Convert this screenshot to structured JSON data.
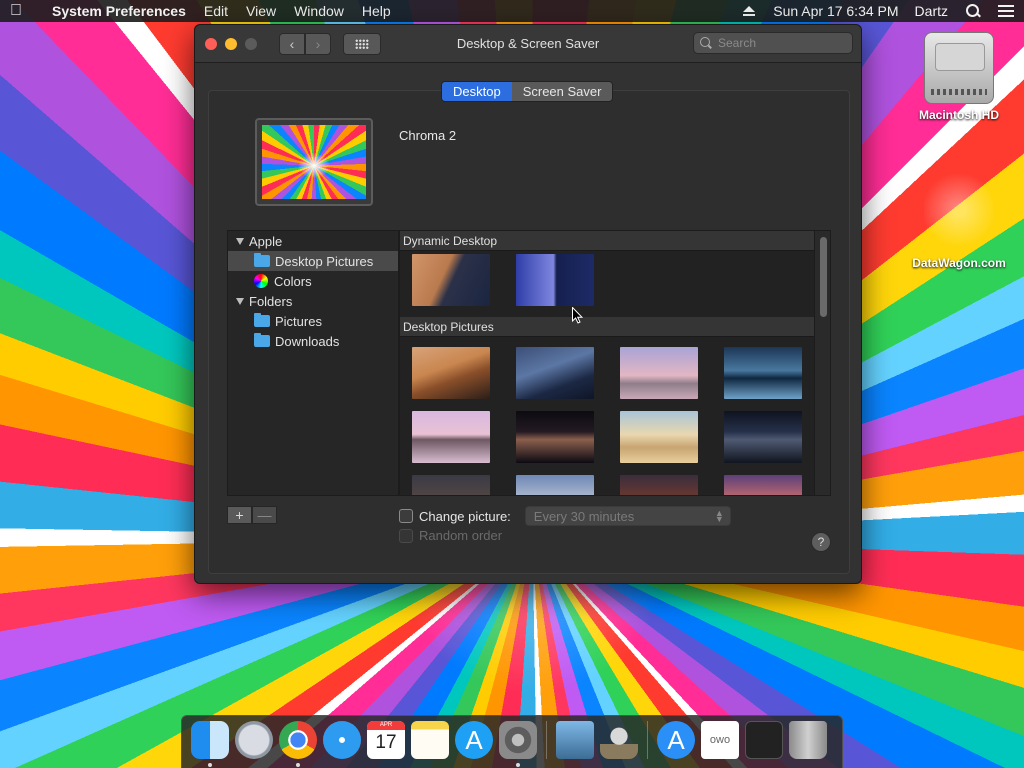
{
  "menubar": {
    "app_name": "System Preferences",
    "menus": [
      "Edit",
      "View",
      "Window",
      "Help"
    ],
    "datetime": "Sun Apr 17  6:34 PM",
    "user": "Dartz"
  },
  "desktop_icons": {
    "hd_label": "Macintosh HD",
    "dw_label": "DataWagon.com"
  },
  "window": {
    "title": "Desktop & Screen Saver",
    "search_placeholder": "Search",
    "tabs": [
      {
        "label": "Desktop",
        "active": true
      },
      {
        "label": "Screen Saver",
        "active": false
      }
    ],
    "current_picture_name": "Chroma 2",
    "sources": [
      {
        "label": "Apple",
        "type": "group"
      },
      {
        "label": "Desktop Pictures",
        "type": "child",
        "selected": true,
        "icon": "folder-icon"
      },
      {
        "label": "Colors",
        "type": "child",
        "icon": "color-wheel-icon"
      },
      {
        "label": "Folders",
        "type": "group"
      },
      {
        "label": "Pictures",
        "type": "child",
        "icon": "folder-icon"
      },
      {
        "label": "Downloads",
        "type": "child",
        "icon": "folder-icon"
      }
    ],
    "browser": {
      "sections": [
        {
          "title": "Dynamic Desktop",
          "thumbnails": 2
        },
        {
          "title": "Desktop Pictures",
          "thumbnails": 12
        }
      ]
    },
    "controls": {
      "change_picture_label": "Change picture:",
      "change_picture_checked": false,
      "interval_value": "Every 30 minutes",
      "random_order_label": "Random order",
      "random_order_enabled": false,
      "add_label": "+",
      "remove_label": "—",
      "help_label": "?"
    }
  },
  "dock": {
    "calendar_month": "APR",
    "calendar_day": "17",
    "owo_text": "owo"
  }
}
